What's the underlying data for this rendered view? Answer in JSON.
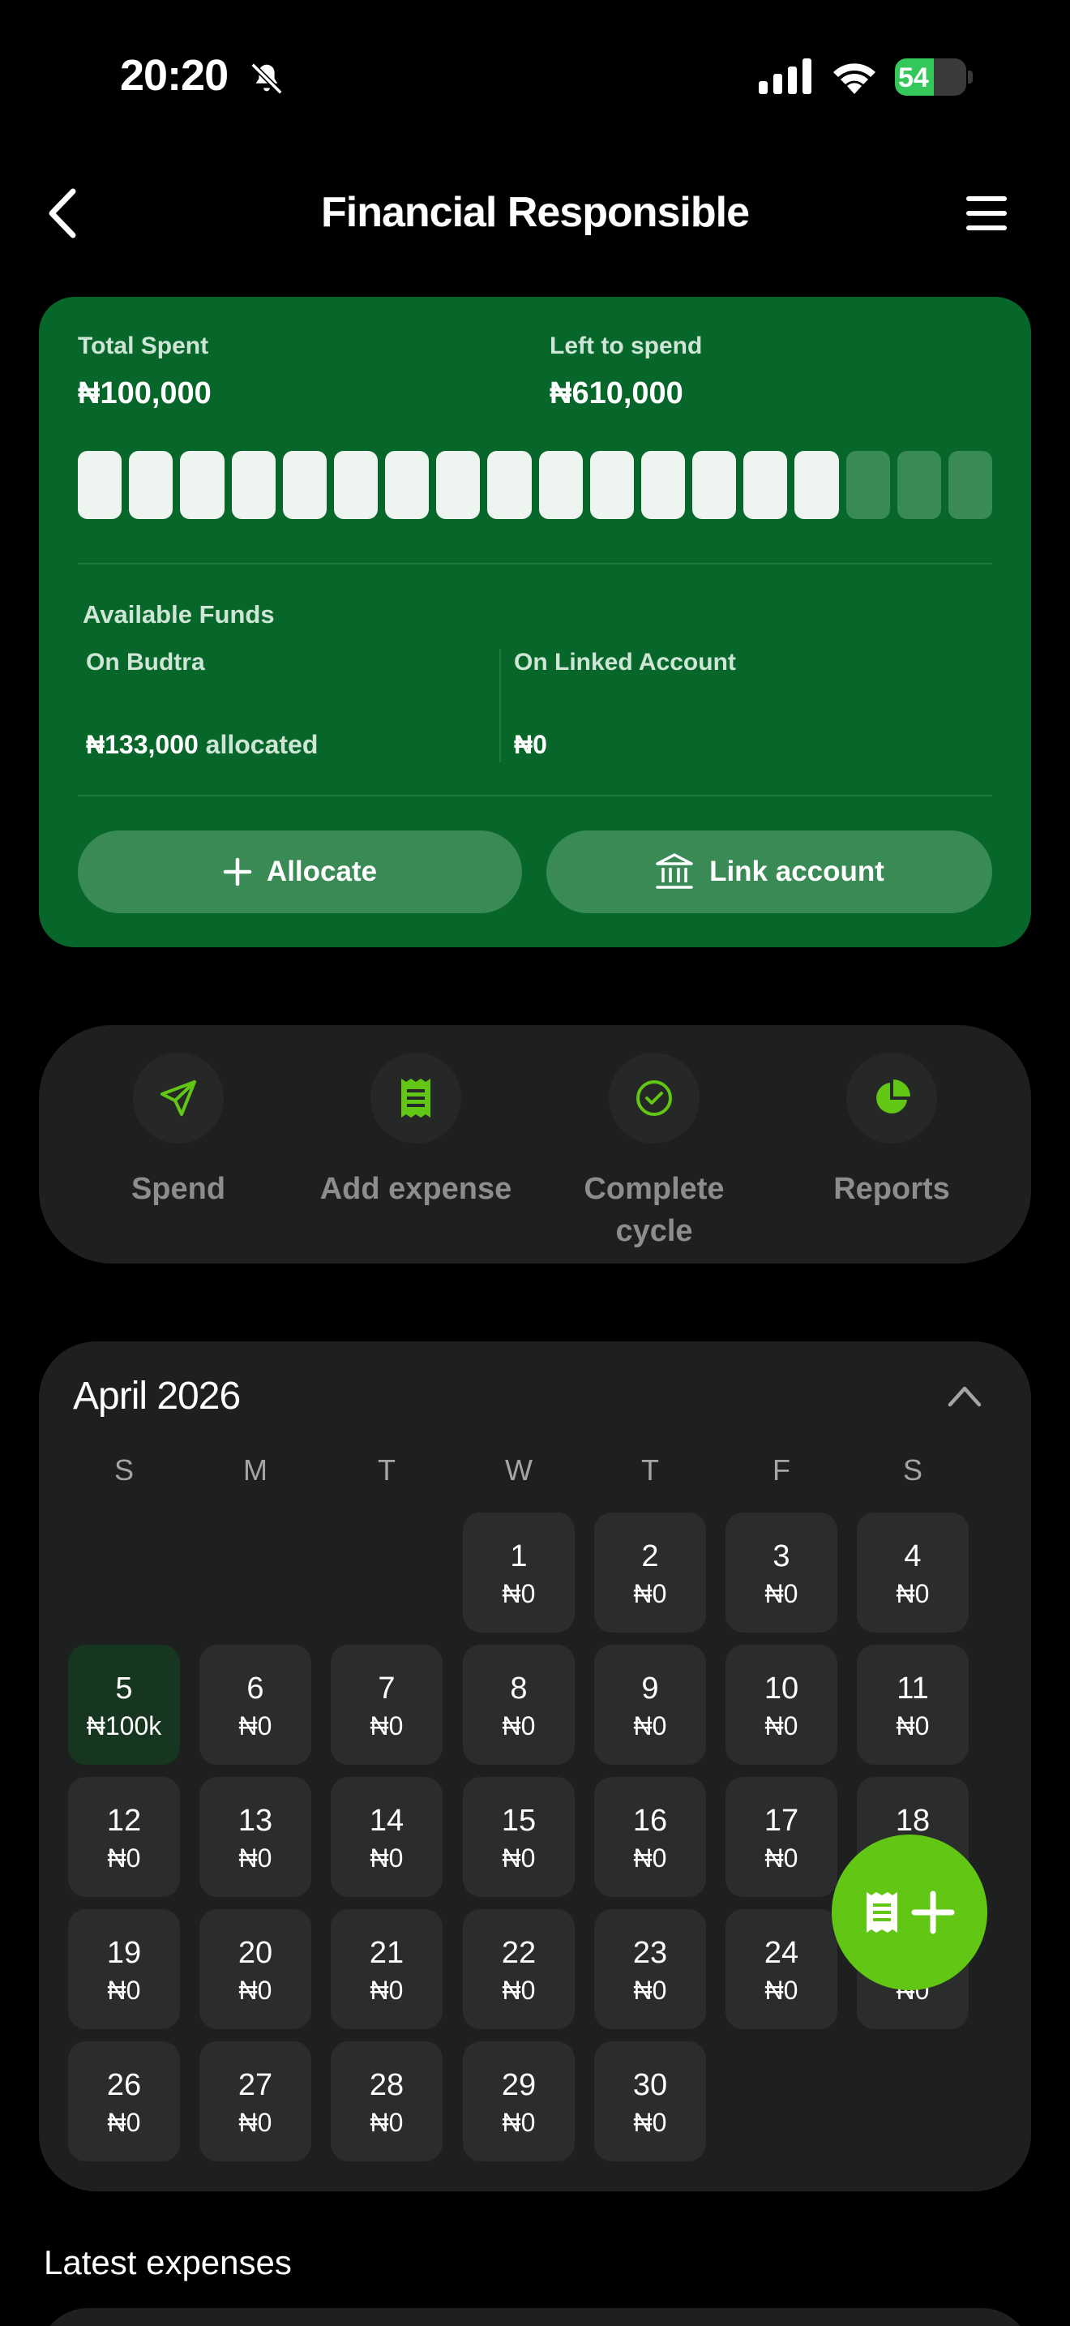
{
  "status_bar": {
    "time": "20:20",
    "battery": "54",
    "battery_level": 0.54
  },
  "nav": {
    "title": "Financial Responsible"
  },
  "summary": {
    "total_spent_label": "Total Spent",
    "total_spent_value": "₦100,000",
    "left_label": "Left to spend",
    "left_value": "₦610,000",
    "progress": {
      "segments_total": 18,
      "segments_filled": 15
    },
    "available_funds_label": "Available Funds",
    "on_budtra_label": "On Budtra",
    "on_budtra_value": "₦133,000",
    "on_budtra_suffix": "allocated",
    "linked_label": "On Linked Account",
    "linked_value": "₦0",
    "allocate_label": "Allocate",
    "link_label": "Link account"
  },
  "actions": [
    {
      "label": "Spend",
      "icon": "send-icon"
    },
    {
      "label": "Add expense",
      "icon": "receipt-icon"
    },
    {
      "label": "Complete cycle",
      "icon": "check-circle-icon"
    },
    {
      "label": "Reports",
      "icon": "pie-chart-icon"
    }
  ],
  "calendar": {
    "month_label": "April 2026",
    "weekdays": [
      "S",
      "M",
      "T",
      "W",
      "T",
      "F",
      "S"
    ],
    "first_weekday_index": 3,
    "days": [
      {
        "num": "1",
        "amount": "₦0"
      },
      {
        "num": "2",
        "amount": "₦0"
      },
      {
        "num": "3",
        "amount": "₦0"
      },
      {
        "num": "4",
        "amount": "₦0"
      },
      {
        "num": "5",
        "amount": "₦100k",
        "active": true
      },
      {
        "num": "6",
        "amount": "₦0"
      },
      {
        "num": "7",
        "amount": "₦0"
      },
      {
        "num": "8",
        "amount": "₦0"
      },
      {
        "num": "9",
        "amount": "₦0"
      },
      {
        "num": "10",
        "amount": "₦0"
      },
      {
        "num": "11",
        "amount": "₦0"
      },
      {
        "num": "12",
        "amount": "₦0"
      },
      {
        "num": "13",
        "amount": "₦0"
      },
      {
        "num": "14",
        "amount": "₦0"
      },
      {
        "num": "15",
        "amount": "₦0"
      },
      {
        "num": "16",
        "amount": "₦0"
      },
      {
        "num": "17",
        "amount": "₦0"
      },
      {
        "num": "18",
        "amount": "₦0"
      },
      {
        "num": "19",
        "amount": "₦0"
      },
      {
        "num": "20",
        "amount": "₦0"
      },
      {
        "num": "21",
        "amount": "₦0"
      },
      {
        "num": "22",
        "amount": "₦0"
      },
      {
        "num": "23",
        "amount": "₦0"
      },
      {
        "num": "24",
        "amount": "₦0"
      },
      {
        "num": "25",
        "amount": "₦0"
      },
      {
        "num": "26",
        "amount": "₦0"
      },
      {
        "num": "27",
        "amount": "₦0"
      },
      {
        "num": "28",
        "amount": "₦0"
      },
      {
        "num": "29",
        "amount": "₦0"
      },
      {
        "num": "30",
        "amount": "₦0"
      }
    ]
  },
  "latest": {
    "title": "Latest expenses"
  },
  "colors": {
    "card_green": "#07662a",
    "accent_green": "#61c614",
    "segment_filled": "#eef4ef",
    "segment_empty": "#3a8a56",
    "surface": "#1e1f1f"
  }
}
